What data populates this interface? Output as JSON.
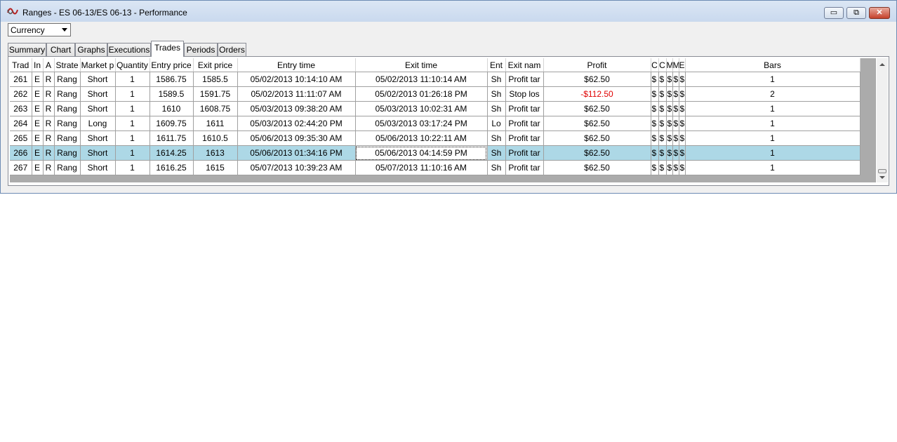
{
  "window": {
    "title": "Ranges - ES 06-13/ES 06-13 - Performance",
    "controls": {
      "minimize": "▭",
      "maximize": "⧉",
      "close": "✕"
    }
  },
  "currency_select": {
    "value": "Currency"
  },
  "tabs": [
    "Summary",
    "Chart",
    "Graphs",
    "Executions",
    "Trades",
    "Periods",
    "Orders"
  ],
  "active_tab": "Trades",
  "table": {
    "columns": [
      "Trad",
      "In",
      "A",
      "Strate",
      "Market p",
      "Quantity",
      "Entry price",
      "Exit price",
      "Entry time",
      "Exit time",
      "Ent",
      "Exit nam",
      "Profit",
      "C",
      "C",
      "M",
      "M",
      "E",
      "Bars"
    ],
    "rows": [
      [
        "261",
        "E",
        "R",
        "Rang",
        "Short",
        "1",
        "1586.75",
        "1585.5",
        "05/02/2013 10:14:10 AM",
        "05/02/2013 11:10:14 AM",
        "Sh",
        "Profit tar",
        "$62.50",
        "$",
        "$",
        "$",
        "$",
        "$",
        "1"
      ],
      [
        "262",
        "E",
        "R",
        "Rang",
        "Short",
        "1",
        "1589.5",
        "1591.75",
        "05/02/2013 11:11:07 AM",
        "05/02/2013 01:26:18 PM",
        "Sh",
        "Stop los",
        "-$112.50",
        "$",
        "$",
        "$",
        "$",
        "$",
        "2"
      ],
      [
        "263",
        "E",
        "R",
        "Rang",
        "Short",
        "1",
        "1610",
        "1608.75",
        "05/03/2013 09:38:20 AM",
        "05/03/2013 10:02:31 AM",
        "Sh",
        "Profit tar",
        "$62.50",
        "$",
        "$",
        "$",
        "$",
        "$",
        "1"
      ],
      [
        "264",
        "E",
        "R",
        "Rang",
        "Long",
        "1",
        "1609.75",
        "1611",
        "05/03/2013 02:44:20 PM",
        "05/03/2013 03:17:24 PM",
        "Lo",
        "Profit tar",
        "$62.50",
        "$",
        "$",
        "$",
        "$",
        "$",
        "1"
      ],
      [
        "265",
        "E",
        "R",
        "Rang",
        "Short",
        "1",
        "1611.75",
        "1610.5",
        "05/06/2013 09:35:30 AM",
        "05/06/2013 10:22:11 AM",
        "Sh",
        "Profit tar",
        "$62.50",
        "$",
        "$",
        "$",
        "$",
        "$",
        "1"
      ],
      [
        "266",
        "E",
        "R",
        "Rang",
        "Short",
        "1",
        "1614.25",
        "1613",
        "05/06/2013 01:34:16 PM",
        "05/06/2013 04:14:59 PM",
        "Sh",
        "Profit tar",
        "$62.50",
        "$",
        "$",
        "$",
        "$",
        "$",
        "1"
      ],
      [
        "267",
        "E",
        "R",
        "Rang",
        "Short",
        "1",
        "1616.25",
        "1615",
        "05/07/2013 10:39:23 AM",
        "05/07/2013 11:10:16 AM",
        "Sh",
        "Profit tar",
        "$62.50",
        "$",
        "$",
        "$",
        "$",
        "$",
        "1"
      ]
    ],
    "selected_row_index": 5,
    "negative_color": "#e00000",
    "selection_color": "#add8e6"
  }
}
